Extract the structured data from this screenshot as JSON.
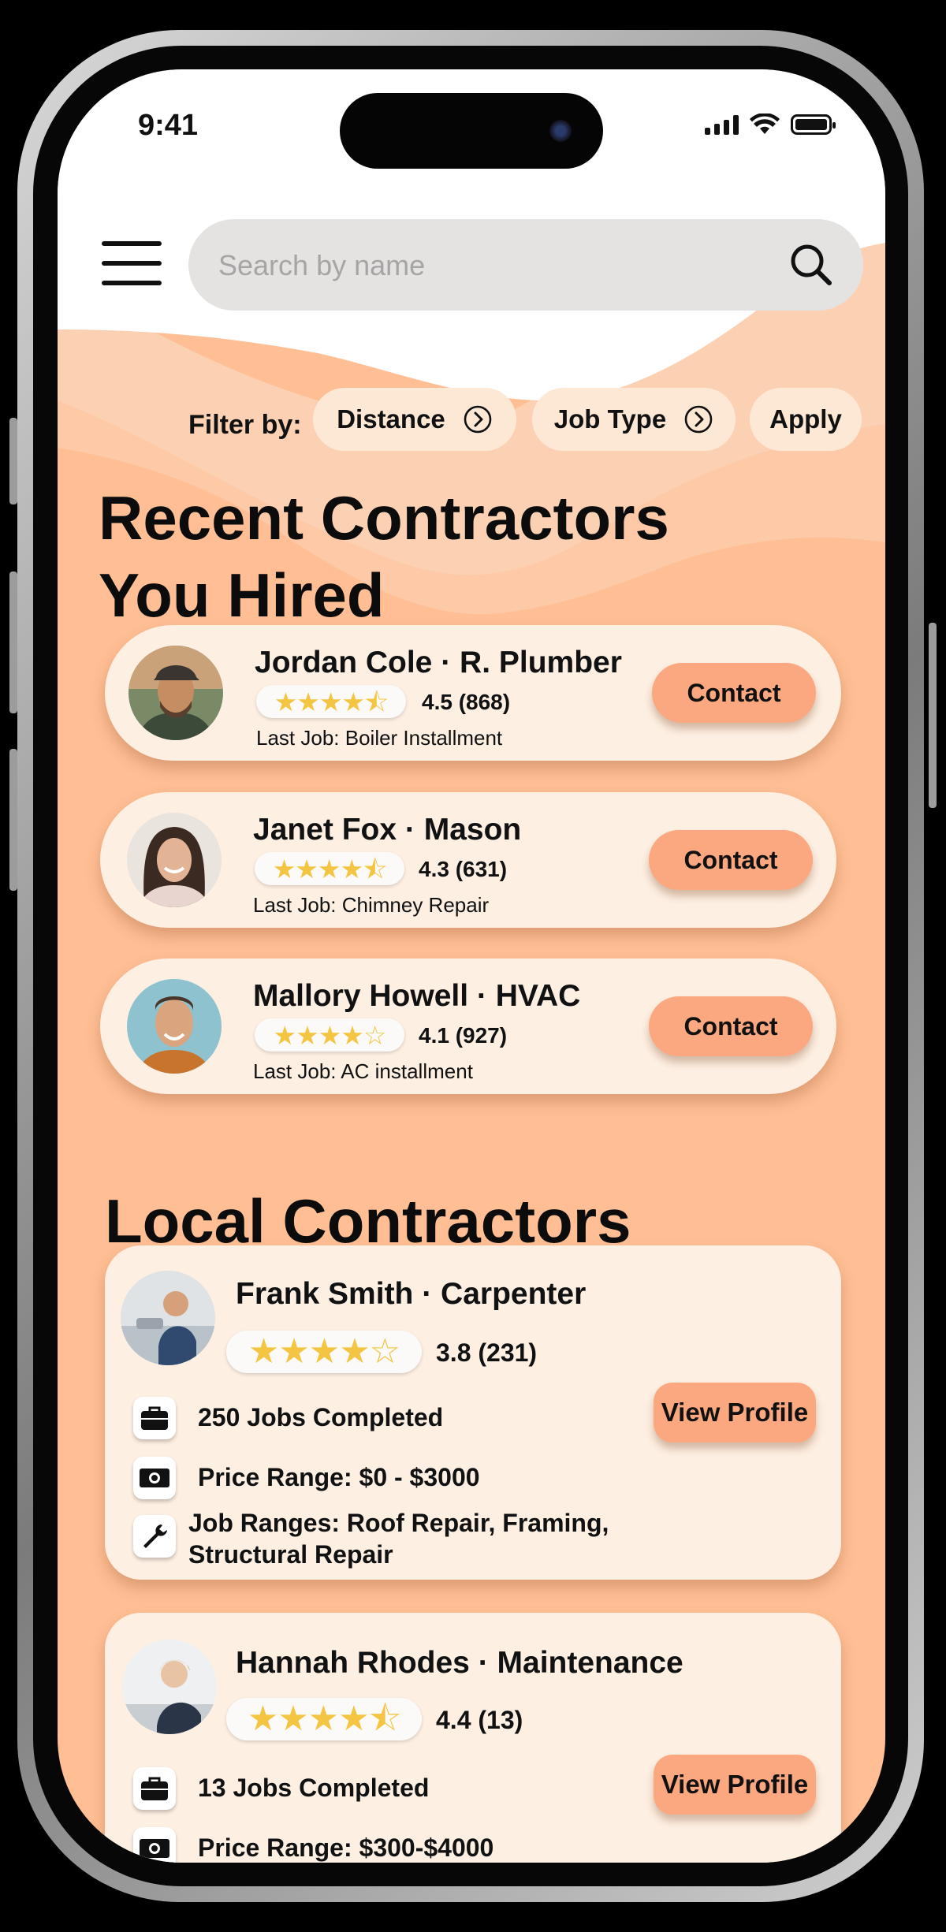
{
  "status_bar": {
    "time": "9:41"
  },
  "search": {
    "placeholder": "Search by name"
  },
  "filters": {
    "label": "Filter by:",
    "chips": [
      "Distance",
      "Job Type"
    ],
    "apply_label": "Apply"
  },
  "recent": {
    "title_line1": "Recent Contractors",
    "title_line2": "You Hired",
    "contractors": [
      {
        "name": "Jordan Cole · R. Plumber",
        "stars": "★★★★⯪",
        "rating": "4.5 (868)",
        "last_job": "Last Job: Boiler Installment",
        "button": "Contact"
      },
      {
        "name": "Janet Fox · Mason",
        "stars": "★★★★⯪",
        "rating": "4.3  (631)",
        "last_job": "Last Job: Chimney Repair",
        "button": "Contact"
      },
      {
        "name": "Mallory Howell · HVAC",
        "stars": "★★★★☆",
        "rating": "4.1  (927)",
        "last_job": "Last Job: AC installment",
        "button": "Contact"
      }
    ]
  },
  "local": {
    "title": "Local Contractors",
    "contractors": [
      {
        "name": "Frank Smith · Carpenter",
        "stars": "★★★★☆",
        "rating": "3.8  (231)",
        "jobs": "250 Jobs Completed",
        "price": "Price Range: $0 - $3000",
        "job_ranges_line1": "Job Ranges: Roof Repair, Framing,",
        "job_ranges_line2": "Structural Repair",
        "button": "View Profile"
      },
      {
        "name": "Hannah Rhodes · Maintenance",
        "stars": "★★★★⯪",
        "rating": "4.4  (13)",
        "jobs": "13 Jobs Completed",
        "price": "Price Range: $300-$4000",
        "button": "View Profile"
      }
    ]
  },
  "icons": {
    "menu": "hamburger-menu-icon",
    "search": "search-icon",
    "chevron": "chevron-right-circle-icon",
    "jobs": "briefcase-icon",
    "price": "money-icon",
    "job_ranges": "wrench-icon"
  },
  "colors": {
    "background": "#ffbe94",
    "card": "#fdefe2",
    "button": "#fba880",
    "star": "#f4c542",
    "chip": "#fde8d6"
  }
}
